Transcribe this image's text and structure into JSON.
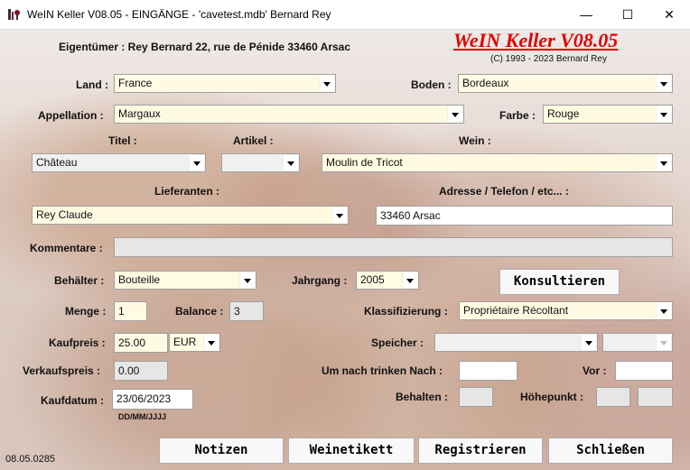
{
  "window": {
    "title": "WeIN Keller V08.05  - EINGÄNGE -  'cavetest.mdb'   Bernard Rey",
    "minimize": "—",
    "maximize": "☐",
    "close": "✕"
  },
  "header": {
    "owner": "Eigentümer : Rey Bernard 22, rue de Pénide 33460 Arsac",
    "brand": "WeIN Keller V08.05",
    "copyright": "(C) 1993 - 2023 Bernard Rey"
  },
  "labels": {
    "land": "Land :",
    "boden": "Boden :",
    "appellation": "Appellation :",
    "farbe": "Farbe :",
    "titel": "Titel :",
    "artikel": "Artikel :",
    "wein": "Wein :",
    "lieferanten": "Lieferanten :",
    "adresse": "Adresse / Telefon / etc... :",
    "kommentare": "Kommentare :",
    "behaelter": "Behälter :",
    "jahrgang": "Jahrgang :",
    "menge": "Menge :",
    "balance": "Balance :",
    "klassifizierung": "Klassifizierung :",
    "kaufpreis": "Kaufpreis :",
    "speicher": "Speicher :",
    "verkaufspreis": "Verkaufspreis :",
    "trinken": "Um nach trinken Nach :",
    "vor": "Vor :",
    "kaufdatum": "Kaufdatum :",
    "behalten": "Behalten :",
    "hoehepunkt": "Höhepunkt :",
    "date_hint": "DD/MM/JJJJ"
  },
  "values": {
    "land": "France",
    "boden": "Bordeaux",
    "appellation": "Margaux",
    "farbe": "Rouge",
    "titel": "Château",
    "artikel": "",
    "wein": "Moulin de Tricot",
    "lieferanten": "Rey Claude",
    "adresse": "33460 Arsac",
    "kommentare": "",
    "behaelter": "Bouteille",
    "jahrgang": "2005",
    "menge": "1",
    "balance": "3",
    "klassifizierung": "Propriétaire Récoltant",
    "kaufpreis": "25.00",
    "waehrung": "EUR",
    "speicher": "",
    "speicher2": "",
    "verkaufspreis": "0.00",
    "trinken": "",
    "vor": "",
    "kaufdatum": "23/06/2023",
    "behalten": "",
    "hoehepunkt1": "",
    "hoehepunkt2": ""
  },
  "buttons": {
    "konsultieren": "Konsultieren",
    "notizen": "Notizen",
    "weinetikett": "Weinetikett",
    "registrieren": "Registrieren",
    "schliessen": "Schließen"
  },
  "status": {
    "version": "08.05.0285"
  },
  "colors": {
    "brand": "#e00000",
    "input_yellow": "#fffbe3"
  },
  "icons": {
    "app": "wine-cellar-icon"
  }
}
